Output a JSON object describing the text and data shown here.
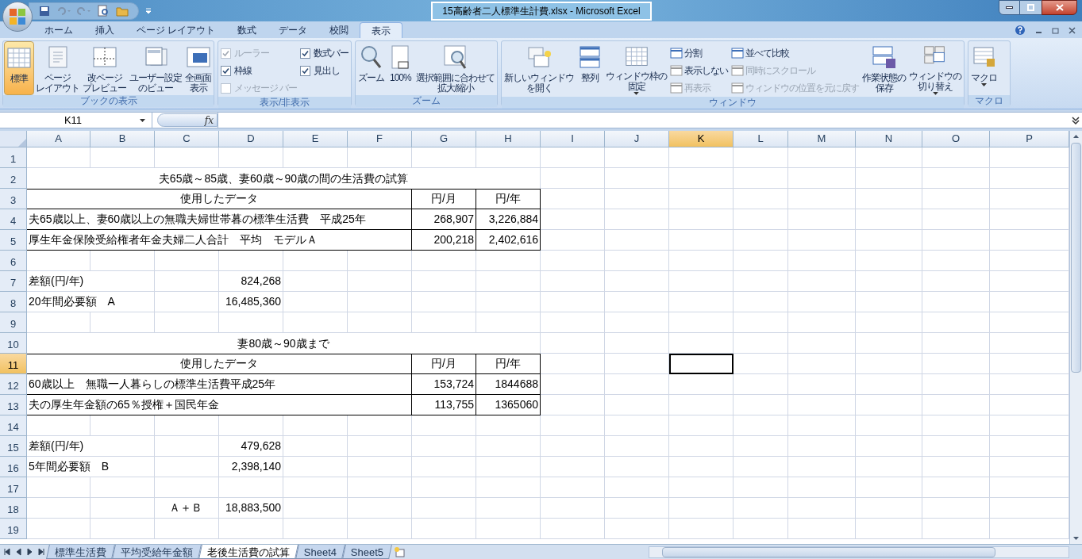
{
  "window": {
    "title": "15高齢者二人標準生計費.xlsx - Microsoft Excel"
  },
  "tabs": [
    {
      "label": "ホーム",
      "selected": false
    },
    {
      "label": "挿入",
      "selected": false
    },
    {
      "label": "ページ レイアウト",
      "selected": false
    },
    {
      "label": "数式",
      "selected": false
    },
    {
      "label": "データ",
      "selected": false
    },
    {
      "label": "校閲",
      "selected": false
    },
    {
      "label": "表示",
      "selected": true
    }
  ],
  "ribbon": [
    {
      "label": "ブックの表示",
      "items": [
        {
          "kind": "large",
          "lines": [
            "標準"
          ],
          "selected": true
        },
        {
          "kind": "large",
          "lines": [
            "ページ",
            "レイアウト"
          ],
          "selected": false
        },
        {
          "kind": "large",
          "lines": [
            "改ページ",
            "プレビュー"
          ],
          "selected": false
        },
        {
          "kind": "large",
          "lines": [
            "ユーザー設定",
            "のビュー"
          ],
          "selected": false
        },
        {
          "kind": "large",
          "lines": [
            "全画面",
            "表示"
          ],
          "selected": false
        }
      ]
    },
    {
      "label": "表示/非表示",
      "items": [
        {
          "kind": "stack",
          "items": [
            {
              "kind": "check",
              "label": "ルーラー",
              "checked": true,
              "disabled": true
            },
            {
              "kind": "check",
              "label": "枠線",
              "checked": true,
              "disabled": false
            },
            {
              "kind": "check",
              "label": "メッセージ バー",
              "checked": false,
              "disabled": true
            }
          ]
        },
        {
          "kind": "stack",
          "items": [
            {
              "kind": "check",
              "label": "数式バー",
              "checked": true,
              "disabled": false
            },
            {
              "kind": "check",
              "label": "見出し",
              "checked": true,
              "disabled": false
            }
          ]
        }
      ]
    },
    {
      "label": "ズーム",
      "items": [
        {
          "kind": "large",
          "lines": [
            "ズーム"
          ],
          "selected": false
        },
        {
          "kind": "large",
          "lines": [
            "100%"
          ],
          "selected": false
        },
        {
          "kind": "large",
          "lines": [
            "選択範囲に合わせて",
            "拡大/縮小"
          ],
          "selected": false
        }
      ]
    },
    {
      "label": "ウィンドウ",
      "items": [
        {
          "kind": "large",
          "lines": [
            "新しいウィンドウ",
            "を開く"
          ],
          "selected": false
        },
        {
          "kind": "large",
          "lines": [
            "整列"
          ],
          "selected": false
        },
        {
          "kind": "large",
          "lines": [
            "ウィンドウ枠の",
            "固定"
          ],
          "selected": false,
          "menu": true
        },
        {
          "kind": "stack",
          "items": [
            {
              "kind": "small",
              "label": "分割",
              "disabled": false
            },
            {
              "kind": "small",
              "label": "表示しない",
              "disabled": false
            },
            {
              "kind": "small",
              "label": "再表示",
              "disabled": true
            }
          ]
        },
        {
          "kind": "stack",
          "items": [
            {
              "kind": "small",
              "label": "並べて比較",
              "disabled": false
            },
            {
              "kind": "small",
              "label": "同時にスクロール",
              "disabled": true
            },
            {
              "kind": "small",
              "label": "ウィンドウの位置を元に戻す",
              "disabled": true
            }
          ]
        },
        {
          "kind": "large",
          "lines": [
            "作業状態の",
            "保存"
          ],
          "selected": false
        },
        {
          "kind": "large",
          "lines": [
            "ウィンドウの",
            "切り替え"
          ],
          "selected": false,
          "menu": true
        }
      ]
    },
    {
      "label": "マクロ",
      "items": [
        {
          "kind": "large",
          "lines": [
            "マクロ"
          ],
          "selected": false,
          "menu": true
        }
      ]
    }
  ],
  "formula_bar": {
    "name_box": "K11",
    "fx": "fx"
  },
  "columns": [
    {
      "label": "A",
      "selected": false
    },
    {
      "label": "B",
      "selected": false
    },
    {
      "label": "C",
      "selected": false
    },
    {
      "label": "D",
      "selected": false
    },
    {
      "label": "E",
      "selected": false
    },
    {
      "label": "F",
      "selected": false
    },
    {
      "label": "G",
      "selected": false
    },
    {
      "label": "H",
      "selected": false
    },
    {
      "label": "I",
      "selected": false
    },
    {
      "label": "J",
      "selected": false
    },
    {
      "label": "K",
      "selected": true
    },
    {
      "label": "L",
      "selected": false
    },
    {
      "label": "M",
      "selected": false
    },
    {
      "label": "N",
      "selected": false
    },
    {
      "label": "O",
      "selected": false
    },
    {
      "label": "P",
      "selected": false
    }
  ],
  "rows": [
    {
      "header": "1",
      "selected": false,
      "kind": "blank"
    },
    {
      "header": "2",
      "selected": false,
      "kind": "title",
      "texts": [
        "夫65歳～85歳、妻60歳～90歳の間の生活費の試算"
      ]
    },
    {
      "header": "3",
      "selected": false,
      "kind": "table_header",
      "texts": [
        "使用したデータ",
        "円/月",
        "円/年"
      ]
    },
    {
      "header": "4",
      "selected": false,
      "kind": "table_row",
      "texts": [
        "夫65歳以上、妻60歳以上の無職夫婦世帯暮の標準生活費　平成25年",
        "268,907",
        "3,226,884"
      ]
    },
    {
      "header": "5",
      "selected": false,
      "kind": "table_row",
      "texts": [
        "厚生年金保険受給権者年金夫婦二人合計　平均　モデルＡ",
        "200,218",
        "2,402,616"
      ]
    },
    {
      "header": "6",
      "selected": false,
      "kind": "blank"
    },
    {
      "header": "7",
      "selected": false,
      "kind": "sum",
      "texts": [
        "差額(円/年)",
        "824,268"
      ]
    },
    {
      "header": "8",
      "selected": false,
      "kind": "sum",
      "texts": [
        "20年間必要額　A",
        "16,485,360"
      ]
    },
    {
      "header": "9",
      "selected": false,
      "kind": "blank"
    },
    {
      "header": "10",
      "selected": false,
      "kind": "title",
      "texts": [
        "妻80歳～90歳まで"
      ]
    },
    {
      "header": "11",
      "selected": true,
      "kind": "table_header",
      "texts": [
        "使用したデータ",
        "円/月",
        "円/年"
      ]
    },
    {
      "header": "12",
      "selected": false,
      "kind": "table_row",
      "texts": [
        "60歳以上　無職一人暮らしの標準生活費平成25年",
        "153,724",
        "1844688"
      ]
    },
    {
      "header": "13",
      "selected": false,
      "kind": "table_row",
      "texts": [
        "夫の厚生年金額の65％授権＋国民年金",
        "113,755",
        "1365060"
      ]
    },
    {
      "header": "14",
      "selected": false,
      "kind": "blank"
    },
    {
      "header": "15",
      "selected": false,
      "kind": "sum",
      "texts": [
        "差額(円/年)",
        "479,628"
      ]
    },
    {
      "header": "16",
      "selected": false,
      "kind": "sum",
      "texts": [
        "5年間必要額　B",
        "2,398,140"
      ]
    },
    {
      "header": "17",
      "selected": false,
      "kind": "blank"
    },
    {
      "header": "18",
      "selected": false,
      "kind": "total",
      "texts": [
        "Ａ＋Ｂ",
        "18,883,500"
      ]
    },
    {
      "header": "19",
      "selected": false,
      "kind": "blank"
    }
  ],
  "sheets": [
    {
      "label": "標準生活費",
      "selected": false
    },
    {
      "label": "平均受給年金額",
      "selected": false
    },
    {
      "label": "老後生活費の試算",
      "selected": true
    },
    {
      "label": "Sheet4",
      "selected": false
    },
    {
      "label": "Sheet5",
      "selected": false
    }
  ]
}
